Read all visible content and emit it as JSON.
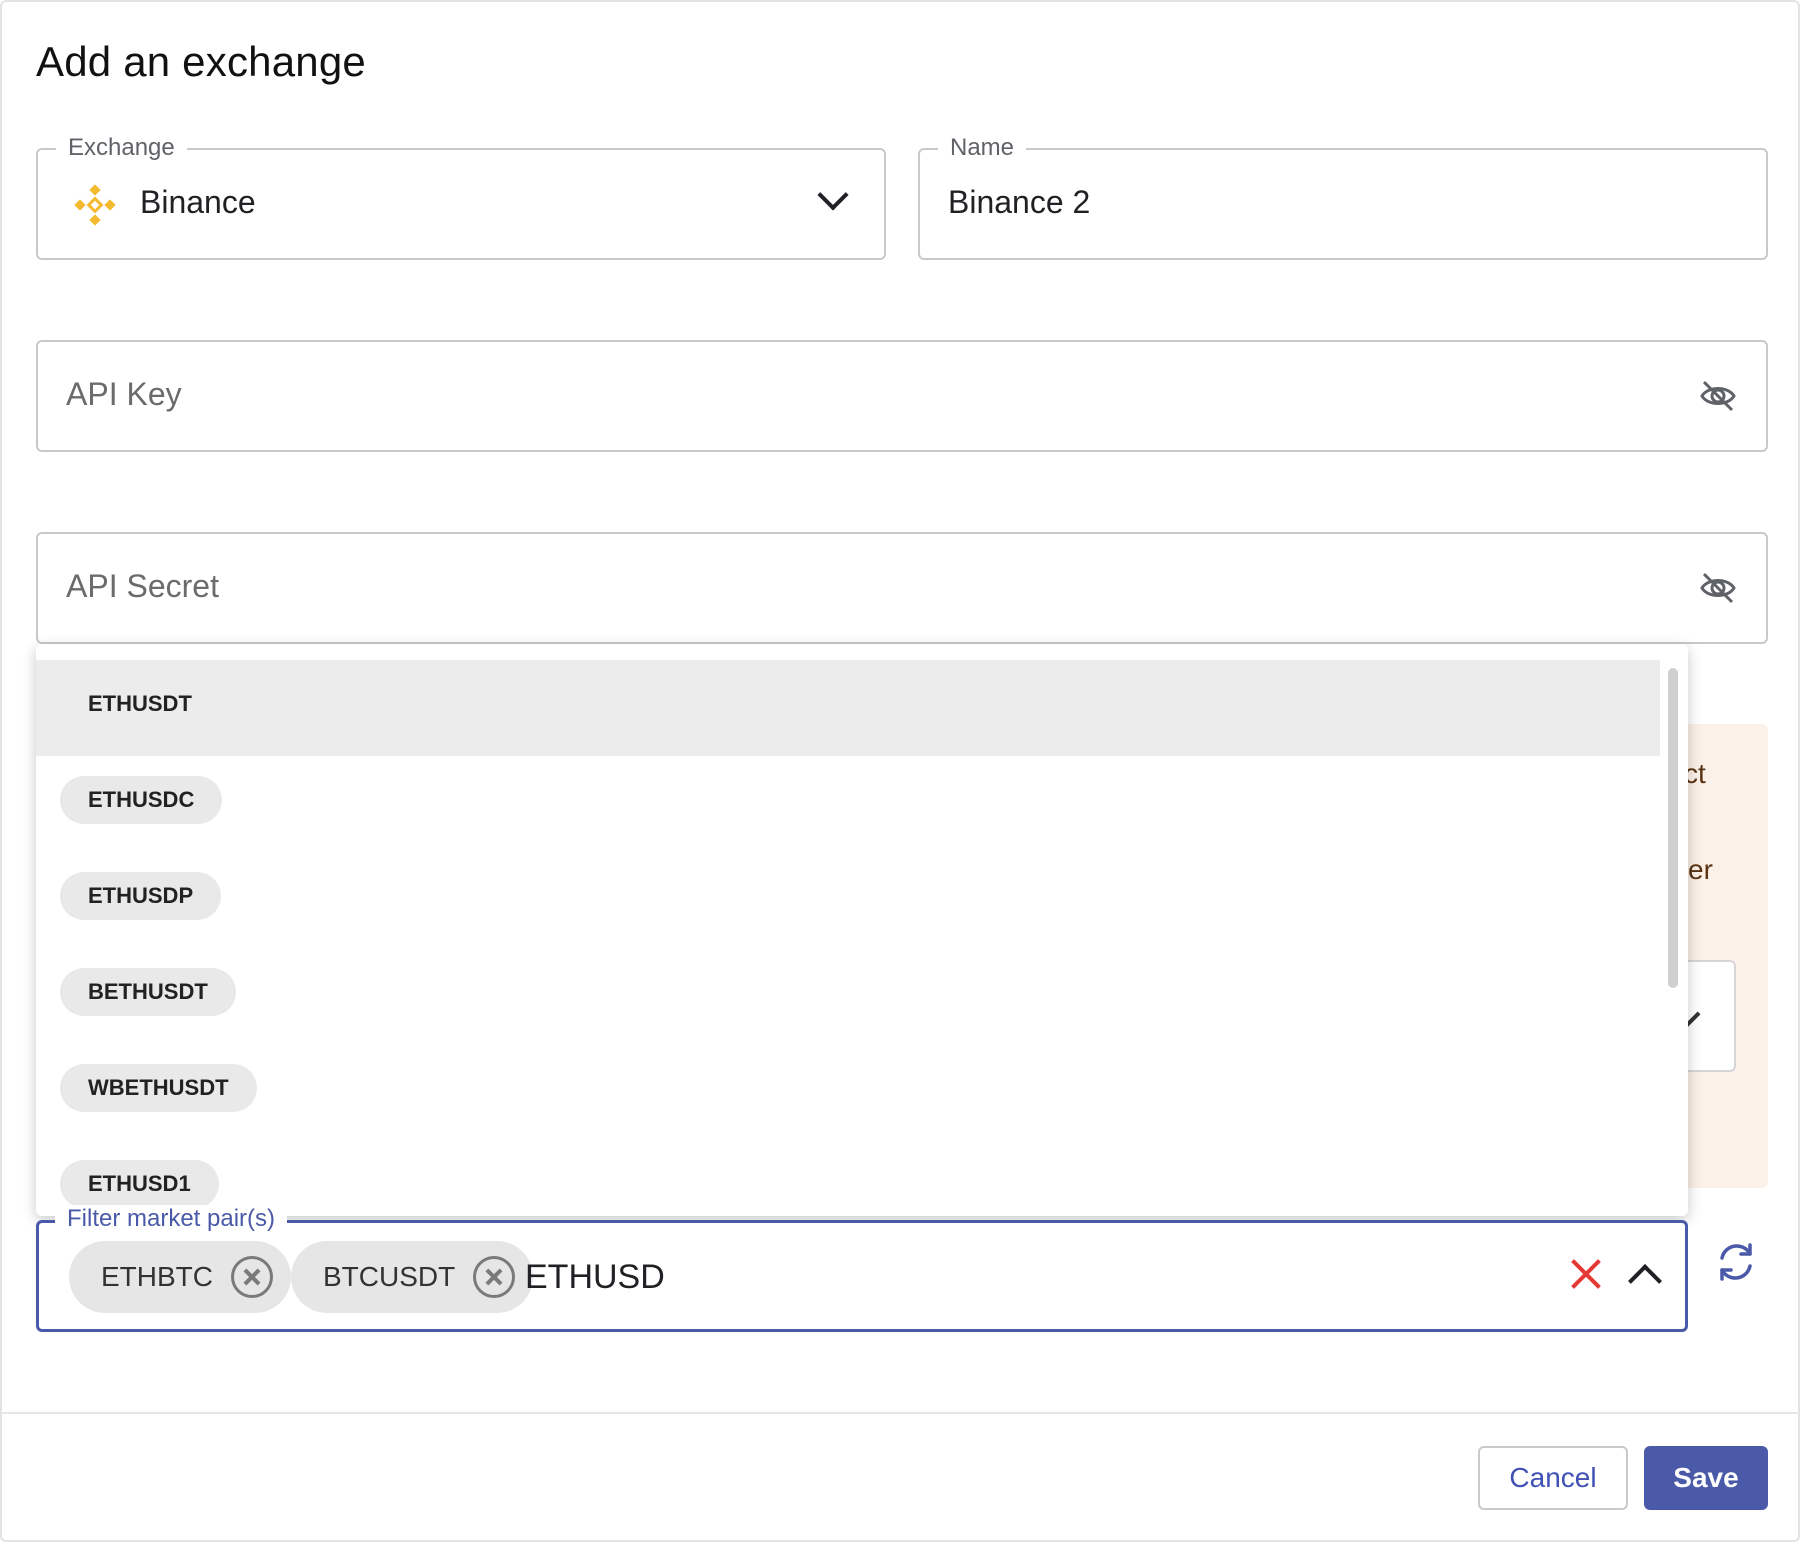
{
  "dialog": {
    "title": "Add an exchange"
  },
  "exchange_field": {
    "label": "Exchange",
    "value": "Binance",
    "icon": "binance-logo-icon"
  },
  "name_field": {
    "label": "Name",
    "value": "Binance 2"
  },
  "api_key_field": {
    "placeholder": "API Key",
    "icon": "eye-off-icon"
  },
  "api_secret_field": {
    "placeholder": "API Secret",
    "icon": "eye-off-icon"
  },
  "warning_fragments": {
    "line1": "ct",
    "line2": "er"
  },
  "dropdown": {
    "options": [
      {
        "label": "ETHUSDT",
        "highlighted": true
      },
      {
        "label": "ETHUSDC"
      },
      {
        "label": "ETHUSDP"
      },
      {
        "label": "BETHUSDT"
      },
      {
        "label": "WBETHUSDT"
      },
      {
        "label": "ETHUSD1"
      }
    ]
  },
  "filter_field": {
    "label": "Filter market pair(s)",
    "chips": [
      "ETHBTC",
      "BTCUSDT"
    ],
    "input_value": "ETHUSD",
    "accent_color": "#4b5aa8",
    "clear_color": "#e53935"
  },
  "refresh_icon": "refresh-icon",
  "footer": {
    "cancel_label": "Cancel",
    "save_label": "Save"
  }
}
